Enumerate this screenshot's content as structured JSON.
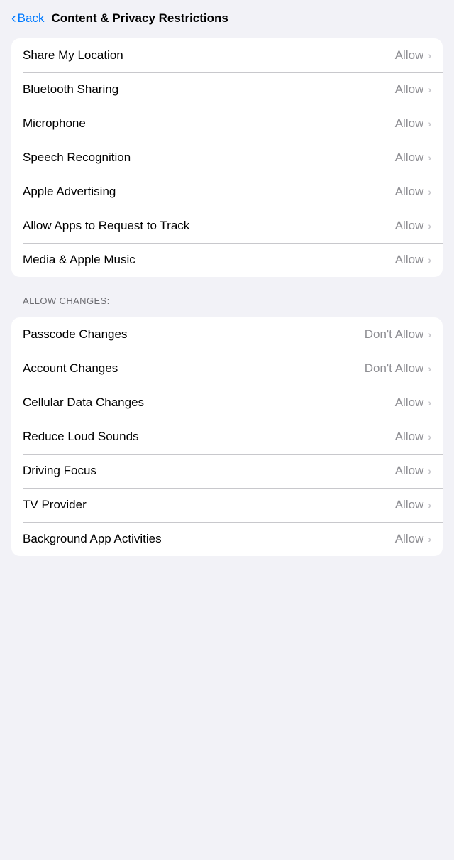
{
  "header": {
    "back_label": "Back",
    "title": "Content & Privacy Restrictions"
  },
  "section1": {
    "rows": [
      {
        "label": "Share My Location",
        "value": "Allow"
      },
      {
        "label": "Bluetooth Sharing",
        "value": "Allow"
      },
      {
        "label": "Microphone",
        "value": "Allow"
      },
      {
        "label": "Speech Recognition",
        "value": "Allow"
      },
      {
        "label": "Apple Advertising",
        "value": "Allow"
      },
      {
        "label": "Allow Apps to Request to Track",
        "value": "Allow"
      },
      {
        "label": "Media & Apple Music",
        "value": "Allow"
      }
    ]
  },
  "section2": {
    "label": "ALLOW CHANGES:",
    "rows": [
      {
        "label": "Passcode Changes",
        "value": "Don't Allow"
      },
      {
        "label": "Account Changes",
        "value": "Don't Allow"
      },
      {
        "label": "Cellular Data Changes",
        "value": "Allow"
      },
      {
        "label": "Reduce Loud Sounds",
        "value": "Allow"
      },
      {
        "label": "Driving Focus",
        "value": "Allow"
      },
      {
        "label": "TV Provider",
        "value": "Allow"
      },
      {
        "label": "Background App Activities",
        "value": "Allow"
      }
    ]
  }
}
